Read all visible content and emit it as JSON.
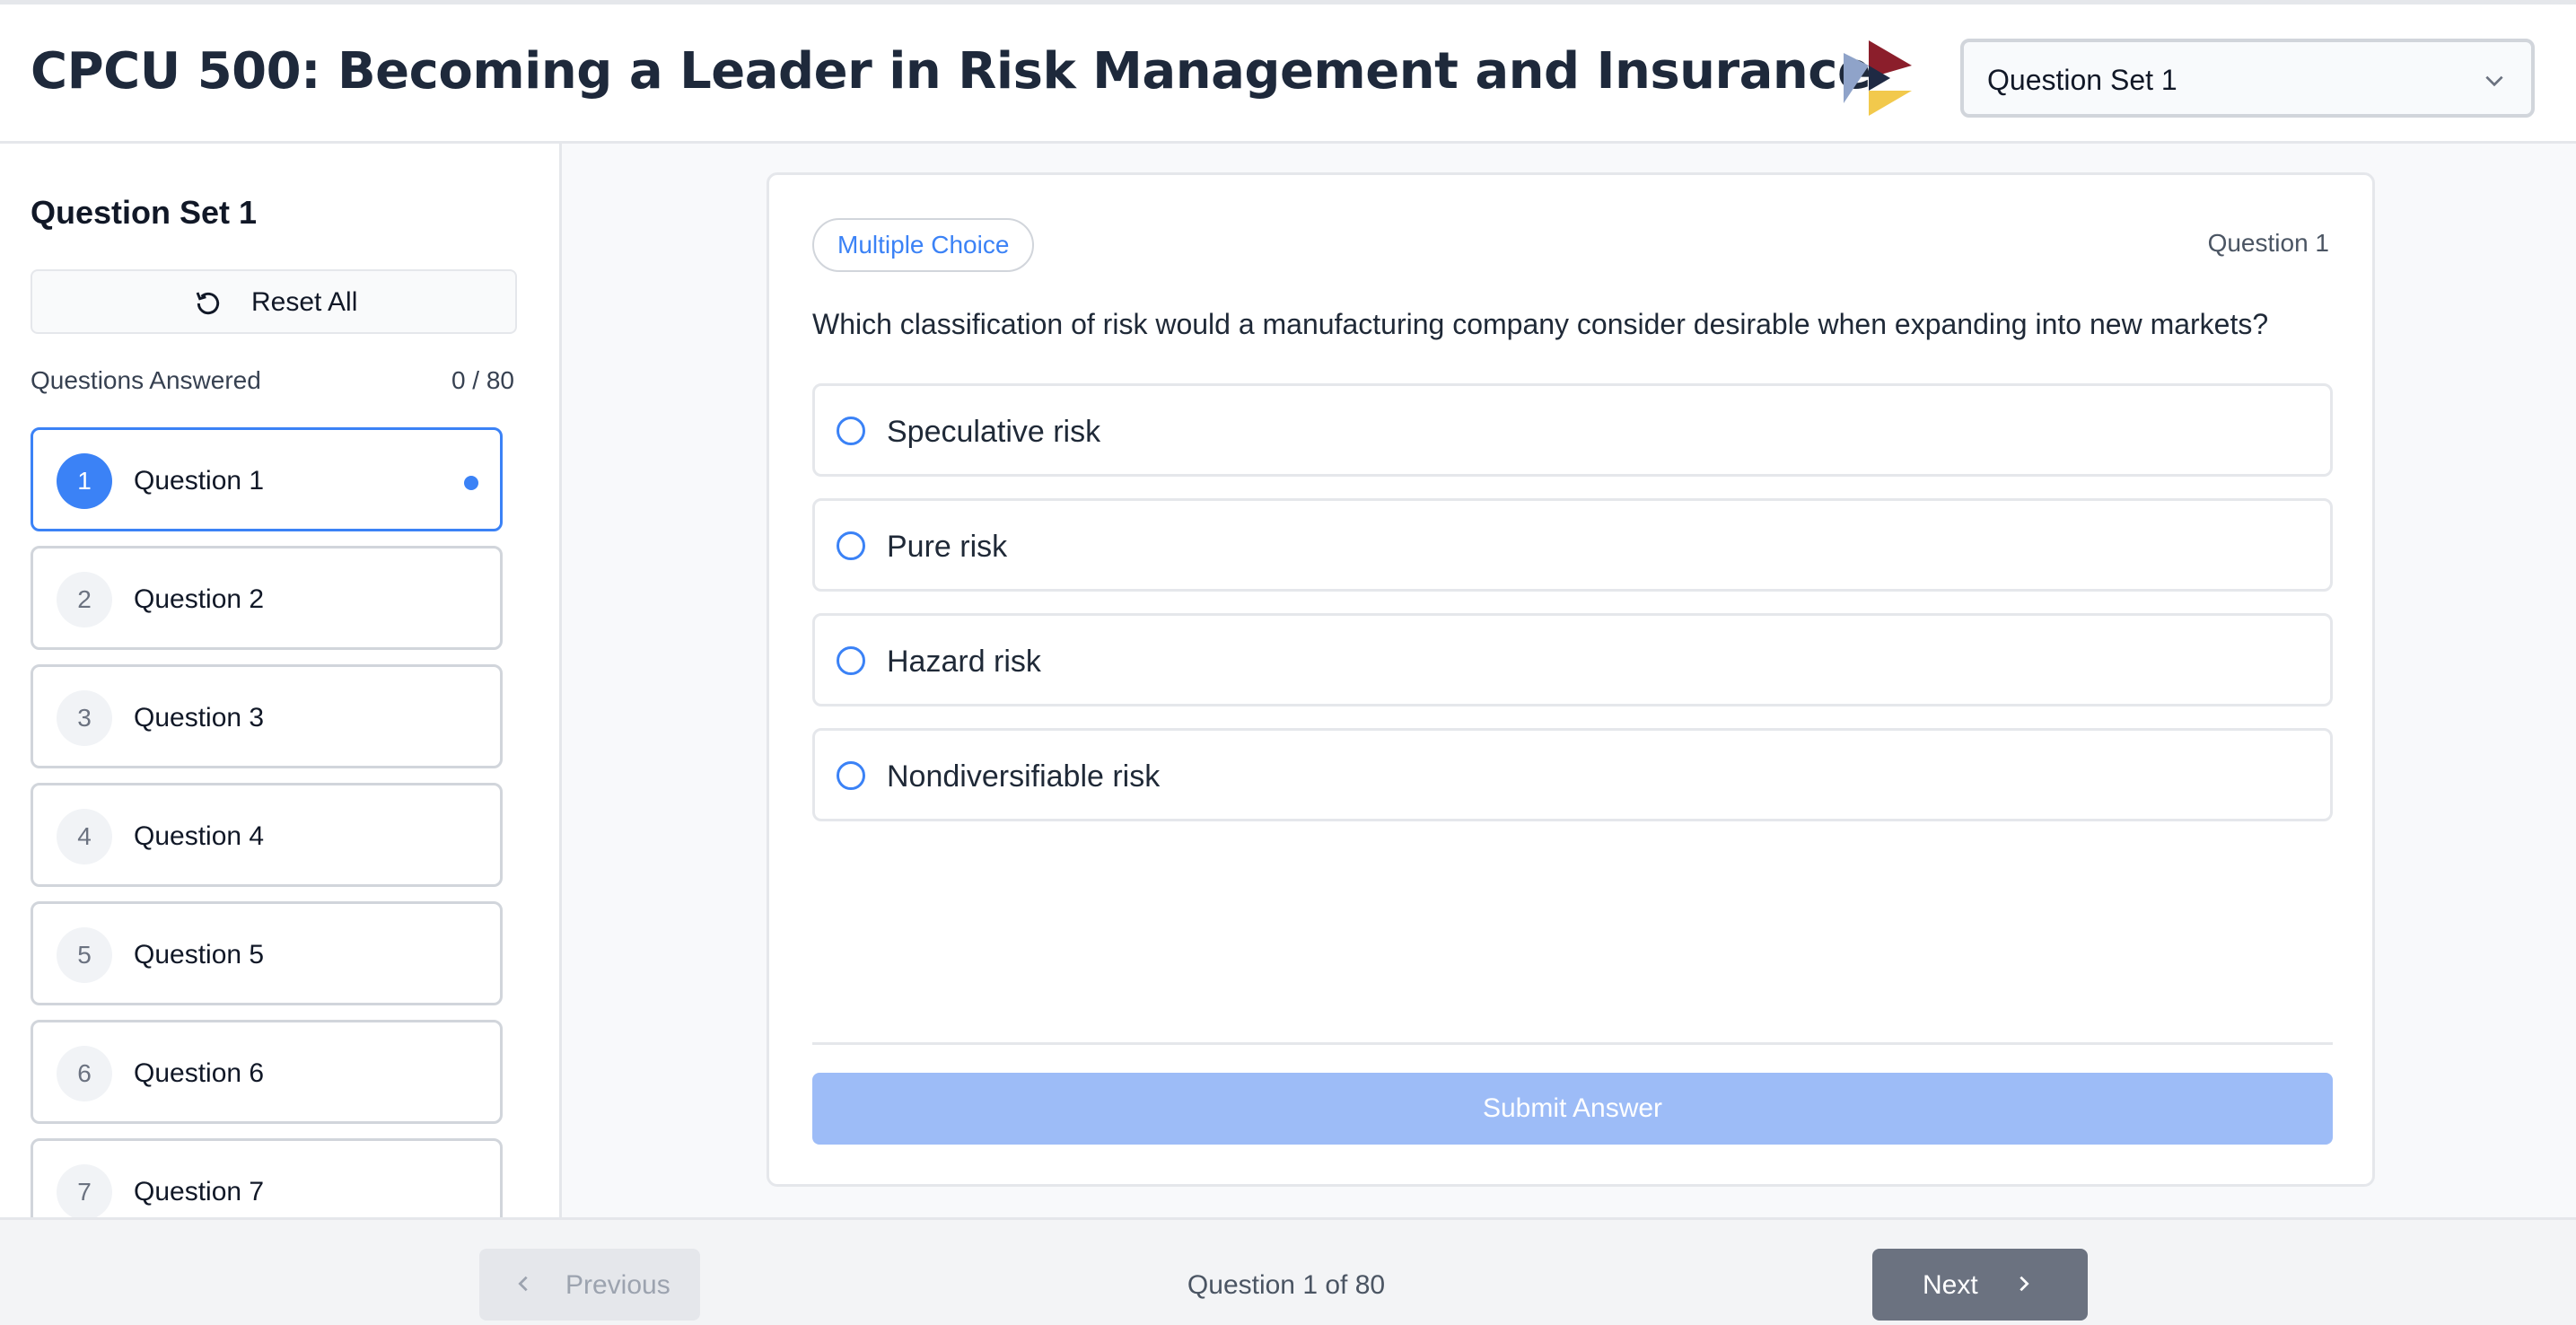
{
  "header": {
    "title": "CPCU 500: Becoming a Leader in Risk Management and Insurance",
    "set_select_value": "Question Set 1"
  },
  "sidebar": {
    "title": "Question Set 1",
    "reset_label": "Reset All",
    "answered_label": "Questions Answered",
    "answered_count": "0 / 80",
    "questions": [
      {
        "number": "1",
        "label": "Question 1"
      },
      {
        "number": "2",
        "label": "Question 2"
      },
      {
        "number": "3",
        "label": "Question 3"
      },
      {
        "number": "4",
        "label": "Question 4"
      },
      {
        "number": "5",
        "label": "Question 5"
      },
      {
        "number": "6",
        "label": "Question 6"
      },
      {
        "number": "7",
        "label": "Question 7"
      }
    ]
  },
  "question": {
    "type_badge": "Multiple Choice",
    "index_label": "Question 1",
    "text": "Which classification of risk would a manufacturing company consider desirable when expanding into new markets?",
    "options": [
      "Speculative risk",
      "Pure risk",
      "Hazard risk",
      "Nondiversifiable risk"
    ],
    "submit_label": "Submit Answer"
  },
  "footer": {
    "previous_label": "Previous",
    "progress": "Question 1 of 80",
    "next_label": "Next"
  },
  "colors": {
    "accent": "#3b82f6",
    "submit_disabled": "#9dbcf7",
    "next_button": "#6b7280",
    "logo_red": "#8b1e2b",
    "logo_navy": "#1f2a44",
    "logo_blue": "#8fa3c9",
    "logo_yellow": "#f2c94c"
  }
}
